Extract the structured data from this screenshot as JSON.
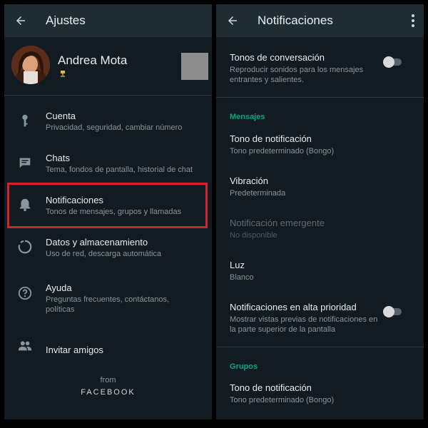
{
  "left": {
    "title": "Ajustes",
    "profile": {
      "name": "Andrea Mota"
    },
    "items": [
      {
        "label": "Cuenta",
        "sub": "Privacidad, seguridad, cambiar número"
      },
      {
        "label": "Chats",
        "sub": "Tema, fondos de pantalla, historial de chat"
      },
      {
        "label": "Notificaciones",
        "sub": "Tonos de mensajes, grupos y llamadas"
      },
      {
        "label": "Datos y almacenamiento",
        "sub": "Uso de red, descarga automática"
      },
      {
        "label": "Ayuda",
        "sub": "Preguntas frecuentes, contáctanos, políticas"
      },
      {
        "label": "Invitar amigos",
        "sub": ""
      }
    ],
    "footer": {
      "from": "from",
      "brand": "FACEBOOK"
    }
  },
  "right": {
    "title": "Notificaciones",
    "conversation_tones": {
      "label": "Tonos de conversación",
      "sub": "Reproducir sonidos para los mensajes entrantes y salientes.",
      "enabled": false
    },
    "messages_section": "Mensajes",
    "messages": [
      {
        "label": "Tono de notificación",
        "sub": "Tono predeterminado (Bongo)"
      },
      {
        "label": "Vibración",
        "sub": "Predeterminada"
      },
      {
        "label": "Notificación emergente",
        "sub": "No disponible",
        "disabled": true
      },
      {
        "label": "Luz",
        "sub": "Blanco"
      },
      {
        "label": "Notificaciones en alta prioridad",
        "sub": "Mostrar vistas previas de notificaciones en la parte superior de la pantalla",
        "enabled": false
      }
    ],
    "groups_section": "Grupos",
    "groups": [
      {
        "label": "Tono de notificación",
        "sub": "Tono predeterminado (Bongo)"
      }
    ]
  },
  "colors": {
    "background": "#121b22",
    "appbar": "#1f2c34",
    "accent": "#00a884",
    "highlight": "#d6222c"
  },
  "icons": {
    "back": "arrow-left-icon",
    "more": "kebab-menu-icon",
    "account": "key-icon",
    "chats": "chat-icon",
    "notifications": "bell-icon",
    "data": "data-circle-icon",
    "help": "help-icon",
    "invite": "people-icon"
  }
}
